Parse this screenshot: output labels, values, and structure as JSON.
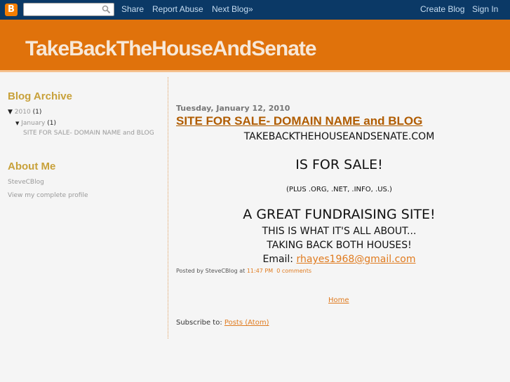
{
  "navbar": {
    "logo": "B",
    "search_placeholder": "",
    "links": {
      "share": "Share",
      "report_abuse": "Report Abuse",
      "next_blog": "Next Blog»",
      "create_blog": "Create Blog",
      "sign_in": "Sign In"
    },
    "icons": {
      "logo": "blogger-logo-icon",
      "search": "search-icon"
    }
  },
  "header": {
    "title": "TakeBackTheHouseAndSenate"
  },
  "sidebar": {
    "archive": {
      "heading": "Blog Archive",
      "year": {
        "toggle": "▼",
        "label": "2010",
        "count": "(1)"
      },
      "month": {
        "toggle": "▼",
        "label": "January",
        "count": "(1)"
      },
      "post": "SITE FOR SALE- DOMAIN NAME and BLOG"
    },
    "about": {
      "heading": "About Me",
      "name": "SteveCBlog",
      "profile_link": "View my complete profile"
    }
  },
  "post": {
    "date": "Tuesday, January 12, 2010",
    "title": "SITE FOR SALE- DOMAIN NAME and BLOG",
    "lines": {
      "domain": "TAKEBACKTHEHOUSEANDSENATE.COM",
      "for_sale": "IS FOR SALE!",
      "variants": "(PLUS .ORG, .NET, .INFO, .US.)",
      "fundraising": "A GREAT FUNDRAISING SITE!",
      "about": "THIS IS WHAT IT'S ALL ABOUT...",
      "taking_back": "TAKING BACK BOTH HOUSES!",
      "email_label": "Email: ",
      "email": "rhayes1968@gmail.com"
    },
    "footer": {
      "posted_by": "Posted by SteveCBlog at ",
      "time": "11:47 PM",
      "comments": "0 comments"
    }
  },
  "nav": {
    "home": "Home"
  },
  "subscribe": {
    "label": "Subscribe to: ",
    "link": "Posts (Atom)"
  }
}
